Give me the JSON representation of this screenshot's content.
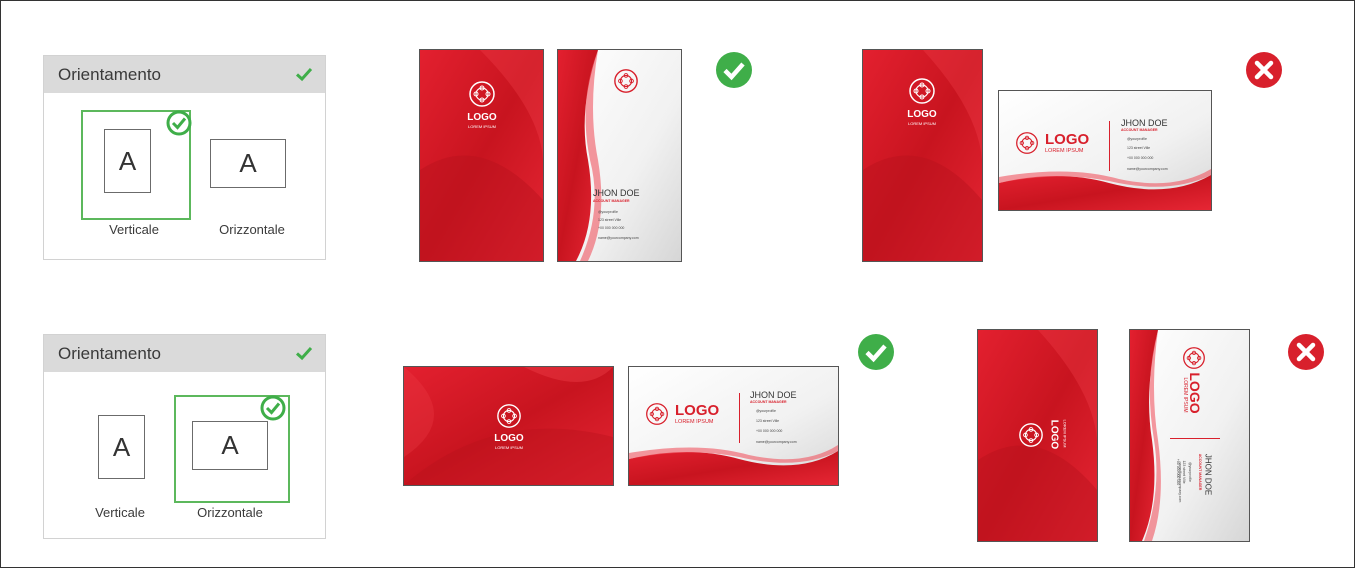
{
  "colors": {
    "accent_red": "#d8202c",
    "ok_green": "#3fae49",
    "bad_red": "#d8202c",
    "header_gray": "#dadada"
  },
  "panels": [
    {
      "title": "Orientamento",
      "check_icon": "check-icon",
      "selected": "Verticale",
      "options": [
        {
          "label": "Verticale",
          "glyph": "A"
        },
        {
          "label": "Orizzontale",
          "glyph": "A"
        }
      ]
    },
    {
      "title": "Orientamento",
      "check_icon": "check-icon",
      "selected": "Orizzontale",
      "options": [
        {
          "label": "Verticale",
          "glyph": "A"
        },
        {
          "label": "Orizzontale",
          "glyph": "A"
        }
      ]
    }
  ],
  "card": {
    "logo": "LOGO",
    "logo_sub": "LOREM IPSUM",
    "name": "JHON DOE",
    "role": "ACCOUNT MANAGER",
    "profile": "@yourprofile",
    "address": "123 street Ville",
    "phone": "+00 000 000 000",
    "email": "name@yourcompany.com"
  },
  "examples": [
    {
      "row": 1,
      "result": "correct",
      "icon": "green-check-circle-icon"
    },
    {
      "row": 1,
      "result": "wrong",
      "icon": "red-x-circle-icon"
    },
    {
      "row": 2,
      "result": "correct",
      "icon": "green-check-circle-icon"
    },
    {
      "row": 2,
      "result": "wrong",
      "icon": "red-x-circle-icon"
    }
  ]
}
